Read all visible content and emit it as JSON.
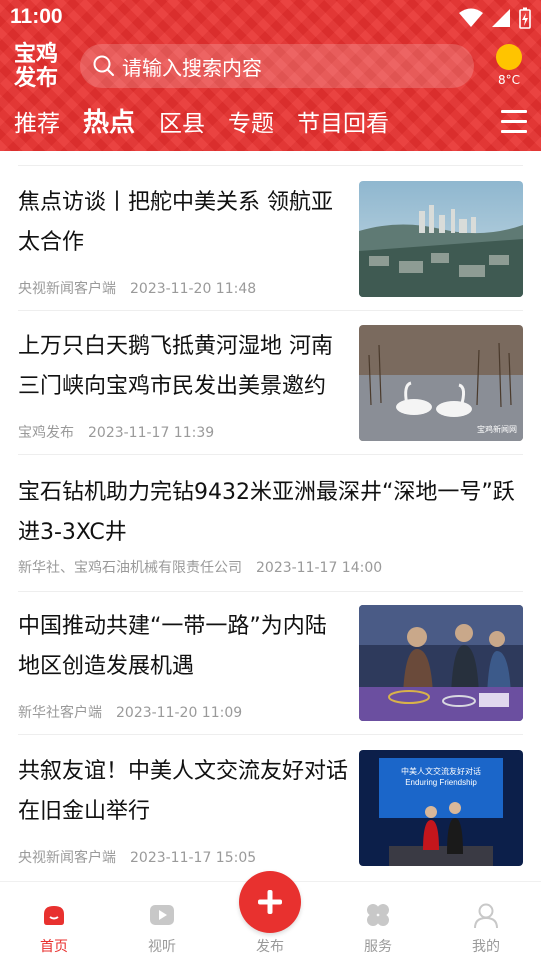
{
  "status": {
    "time": "11:00"
  },
  "header": {
    "logo_line1": "宝鸡",
    "logo_line2": "发布",
    "search_placeholder": "请输入搜索内容",
    "weather_temp": "8°C"
  },
  "tabs": [
    {
      "label": "推荐"
    },
    {
      "label": "热点"
    },
    {
      "label": "区县"
    },
    {
      "label": "专题"
    },
    {
      "label": "节目回看"
    }
  ],
  "feed": [
    {
      "title": "焦点访谈丨把舵中美关系 领航亚太合作",
      "source": "央视新闻客户端",
      "date": "2023-11-20 11:48"
    },
    {
      "title": "上万只白天鹅飞抵黄河湿地 河南三门峡向宝鸡市民发出美景邀约",
      "source": "宝鸡发布",
      "date": "2023-11-17 11:39",
      "watermark": "宝鸡新闻网"
    },
    {
      "title": "宝石钻机助力完钻9432米亚洲最深井“深地一号”跃进3-3XC井",
      "source": "新华社、宝鸡石油机械有限责任公司",
      "date": "2023-11-17 14:00"
    },
    {
      "title": "中国推动共建“一带一路”为内陆地区创造发展机遇",
      "source": "新华社客户端",
      "date": "2023-11-20 11:09"
    },
    {
      "title": "共叙友谊！中美人文交流友好对话在旧金山举行",
      "source": "央视新闻客户端",
      "date": "2023-11-17 15:05",
      "screen_line1": "中美人文交流友好对话",
      "screen_line2": "Enduring Friendship"
    }
  ],
  "nav": [
    {
      "label": "首页"
    },
    {
      "label": "视听"
    },
    {
      "label": "发布"
    },
    {
      "label": "服务"
    },
    {
      "label": "我的"
    }
  ],
  "colors": {
    "accent": "#e8312f",
    "muted": "#9a9a9a"
  }
}
